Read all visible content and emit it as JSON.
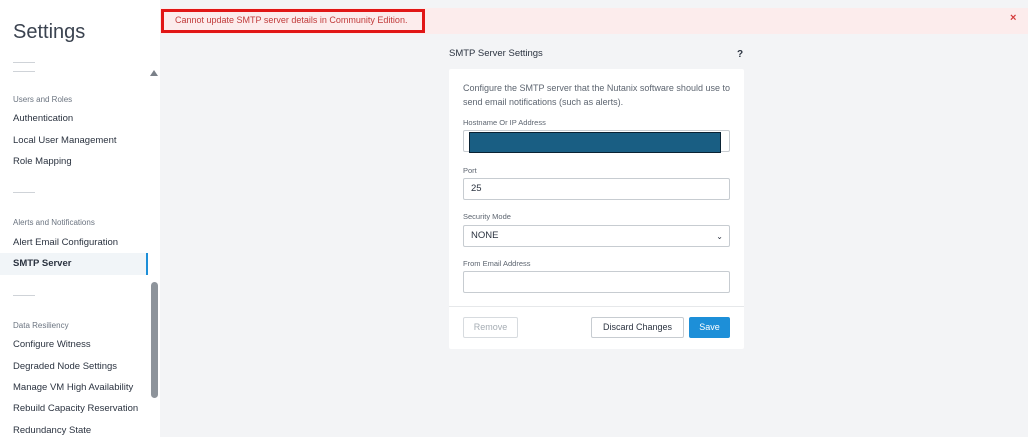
{
  "sidebar": {
    "title": "Settings",
    "groups": [
      {
        "label": "Users and Roles",
        "items": [
          "Authentication",
          "Local User Management",
          "Role Mapping"
        ]
      },
      {
        "label": "Alerts and Notifications",
        "items": [
          "Alert Email Configuration",
          "SMTP Server"
        ]
      },
      {
        "label": "Data Resiliency",
        "items": [
          "Configure Witness",
          "Degraded Node Settings",
          "Manage VM High Availability",
          "Rebuild Capacity Reservation",
          "Redundancy State"
        ]
      }
    ],
    "active_item": "SMTP Server"
  },
  "alert": {
    "message": "Cannot update SMTP server details in Community Edition.",
    "close_glyph": "×",
    "color": "#c03a3a"
  },
  "panel": {
    "title": "SMTP Server Settings",
    "help_glyph": "?",
    "description": "Configure the SMTP server that the Nutanix software should use to send email notifications (such as alerts).",
    "fields": {
      "hostname": {
        "label": "Hostname Or IP Address",
        "value": ""
      },
      "port": {
        "label": "Port",
        "value": "25"
      },
      "security_mode": {
        "label": "Security Mode",
        "value": "NONE"
      },
      "from_email": {
        "label": "From Email Address",
        "value": ""
      }
    },
    "buttons": {
      "remove": "Remove",
      "discard": "Discard Changes",
      "save": "Save"
    }
  },
  "colors": {
    "accent": "#1d8fd8",
    "alert_border": "#e11616",
    "alert_bg": "#fcecec"
  }
}
